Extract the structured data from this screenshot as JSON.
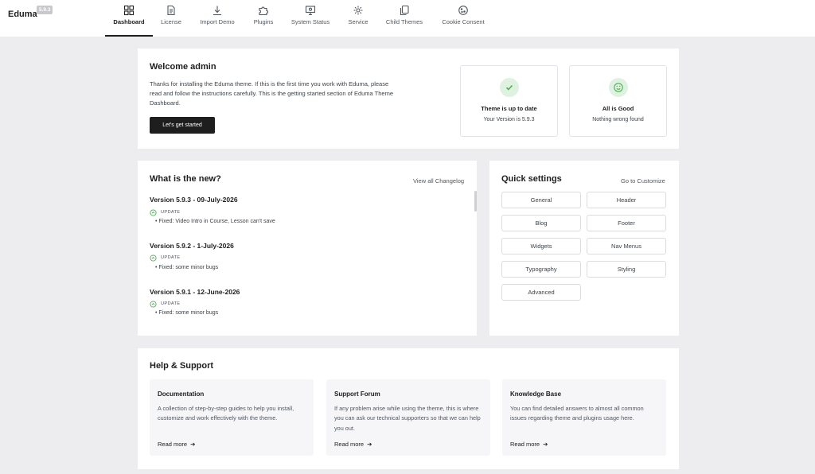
{
  "brand": {
    "name": "Eduma",
    "version": "5.9.3"
  },
  "nav": {
    "tabs": [
      {
        "label": "Dashboard",
        "icon": "grid-icon",
        "active": true
      },
      {
        "label": "License",
        "icon": "document-icon"
      },
      {
        "label": "Import Demo",
        "icon": "download-icon"
      },
      {
        "label": "Plugins",
        "icon": "puzzle-icon"
      },
      {
        "label": "System Status",
        "icon": "monitor-icon"
      },
      {
        "label": "Service",
        "icon": "gear-icon"
      },
      {
        "label": "Child Themes",
        "icon": "copy-icon"
      },
      {
        "label": "Cookie Consent",
        "icon": "cookie-icon"
      }
    ]
  },
  "welcome": {
    "title": "Welcome admin",
    "description": "Thanks for installing the Eduma theme. If this is the first time you work with Eduma, please read and follow the instructions carefully. This is the getting started section of Eduma Theme Dashboard.",
    "button": "Let's get started",
    "status_update": {
      "title": "Theme is up to date",
      "subtitle": "Your Version is 5.9.3"
    },
    "status_health": {
      "title": "All is Good",
      "subtitle": "Nothing wrong found"
    }
  },
  "changelog": {
    "title": "What is the new?",
    "link": "View all Changelog",
    "update_label": "UPDATE",
    "entries": [
      {
        "version": "Version 5.9.3 - 09-July-2026",
        "items": [
          "Fixed: Video Intro in Course, Lesson can't save"
        ]
      },
      {
        "version": "Version 5.9.2 - 1-July-2026",
        "items": [
          "Fixed: some minor bugs"
        ]
      },
      {
        "version": "Version 5.9.1 - 12-June-2026",
        "items": [
          "Fixed: some minor bugs"
        ]
      }
    ]
  },
  "quick_settings": {
    "title": "Quick settings",
    "link": "Go to Customize",
    "buttons": [
      "General",
      "Header",
      "Blog",
      "Footer",
      "Widgets",
      "Nav Menus",
      "Typography",
      "Styling",
      "Advanced"
    ]
  },
  "help": {
    "title": "Help & Support",
    "read_more": "Read more",
    "cards": [
      {
        "title": "Documentation",
        "description": "A collection of step-by-step guides to help you install, customize and work effectively with the theme."
      },
      {
        "title": "Support Forum",
        "description": "If any problem arise while using the theme, this is where you can ask our technical supporters so that we can help you out."
      },
      {
        "title": "Knowledge Base",
        "description": "You can find detailed answers to almost all common issues regarding theme and plugins usage here."
      }
    ]
  },
  "colors": {
    "accent": "#1e1e1e",
    "success": "#4caf50",
    "success_bg": "#dff2e1",
    "background": "#ededf0"
  }
}
